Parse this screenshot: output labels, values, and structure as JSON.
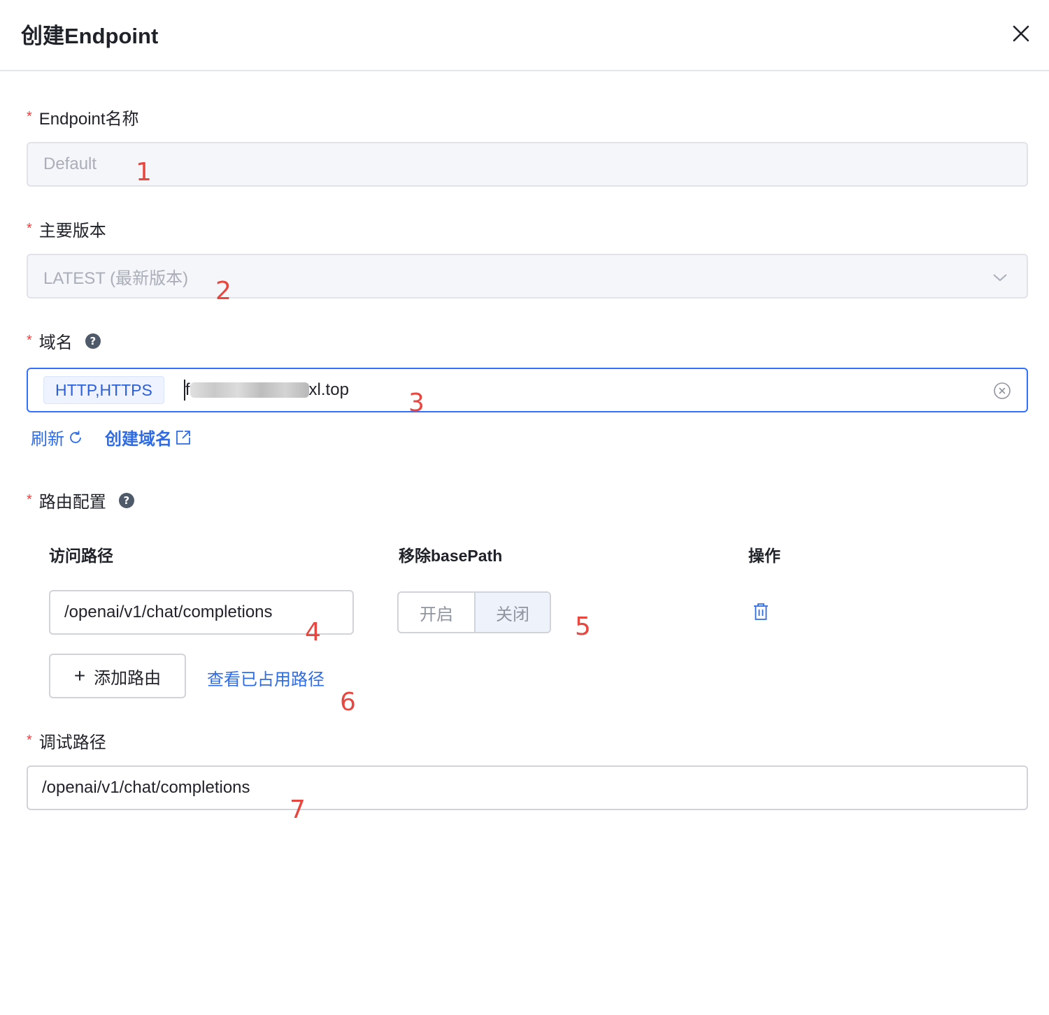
{
  "dialog": {
    "title": "创建Endpoint"
  },
  "form": {
    "name": {
      "label": "Endpoint名称",
      "value": "Default"
    },
    "version": {
      "label": "主要版本",
      "value": "LATEST (最新版本)"
    },
    "domain": {
      "label": "域名",
      "protocol_tag": "HTTP,HTTPS",
      "value_prefix": "f",
      "value_suffix": "xl.top",
      "refresh_label": "刷新",
      "create_label": "创建域名"
    },
    "routes": {
      "label": "路由配置",
      "columns": [
        "访问路径",
        "移除basePath",
        "操作"
      ],
      "rows": [
        {
          "path": "/openai/v1/chat/completions",
          "toggle_on": "开启",
          "toggle_off": "关闭",
          "selected": "关闭"
        }
      ],
      "add_label": "添加路由",
      "view_used_label": "查看已占用路径"
    },
    "debug_path": {
      "label": "调试路径",
      "value": "/openai/v1/chat/completions"
    }
  },
  "annotations": [
    "1",
    "2",
    "3",
    "4",
    "5",
    "6",
    "7"
  ],
  "colors": {
    "accent": "#3370ff",
    "link": "#2e6be6",
    "required": "#f53f3f",
    "annotation": "#e8473f"
  }
}
